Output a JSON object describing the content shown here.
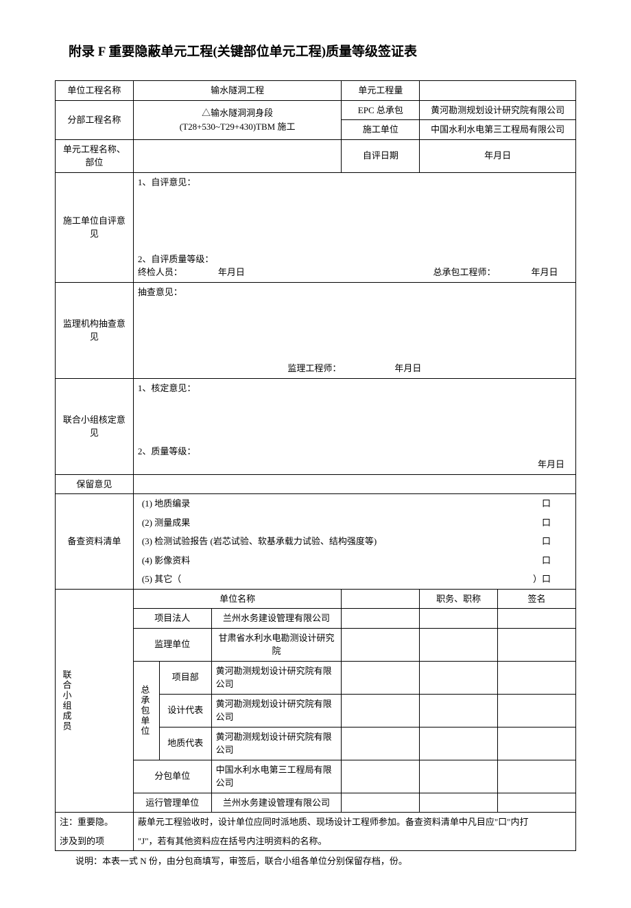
{
  "title": "附录 F 重要隐蔽单元工程(关键部位单元工程)质量等级签证表",
  "labels": {
    "unit_project_name": "单位工程名称",
    "unit_project_qty": "单元工程量",
    "subdivision_name": "分部工程名称",
    "epc_contractor": "EPC 总承包",
    "construction_unit": "施工单位",
    "unit_name_part": "单元工程名称、部位",
    "self_eval_date": "自评日期",
    "date_placeholder": "年月日",
    "contractor_self_opinion": "施工单位自评意见",
    "self_opinion_1": "1、自评意见：",
    "self_opinion_2": "2、自评质量等级：",
    "final_inspector": "终检人员：",
    "general_engineer": "总承包工程师：",
    "supervision_spot": "监理机构抽查意见",
    "spot_check": "抽查意见：",
    "supervision_engineer": "监理工程师：",
    "joint_group_verify": "联合小组核定意见",
    "verify_1": "1、核定意见：",
    "verify_2": "2、质量等级：",
    "reserved_opinion": "保留意见",
    "checklist": "备查资料清单",
    "checklist_1": "(1) 地质编录",
    "checklist_2": "(2) 测量成果",
    "checklist_3": "(3) 检测试验报告 (岩芯试验、软基承载力试验、结构强度等)",
    "checklist_4": "(4) 影像资料",
    "checklist_5": "(5) 其它（",
    "checklist_5_close": "）口",
    "marker": "口",
    "joint_members": "联合小组成员",
    "org_name": "单位名称",
    "position": "职务、职称",
    "signature": "签名",
    "project_owner": "项目法人",
    "supervision_org": "监理单位",
    "general_contractor_unit": "总承包单位",
    "project_dept": "项目部",
    "design_rep": "设计代表",
    "geo_rep": "地质代表",
    "subcontractor": "分包单位",
    "operation_mgmt": "运行管理单位"
  },
  "values": {
    "unit_project_name": "输水隧洞工程",
    "subdivision_name_line1": "△输水隧洞洞身段",
    "subdivision_name_line2": "(T28+530~T29+430)TBM 施工",
    "epc_contractor": "黄河勘测规划设计研究院有限公司",
    "construction_unit": "中国水利水电第三工程局有限公司",
    "project_owner_org": "兰州水务建设管理有限公司",
    "supervision_org_name": "甘肃省水利水电勘测设计研究院",
    "project_dept_org": "黄河勘测规划设计研究院有限公司",
    "design_rep_org": "黄河勘测规划设计研究院有限公司",
    "geo_rep_org": "黄河勘测规划设计研究院有限公司",
    "subcontractor_org": "中国水利水电第三工程局有限公司",
    "operation_mgmt_org": "兰州水务建设管理有限公司"
  },
  "notes": {
    "line1_label": "注：重要隐。",
    "line1_text": "蔽单元工程验收时，设计单位应同时派地质、现场设计工程师参加。备查资料清单中凡目应\"口\"内打",
    "line2_label": "涉及到的项",
    "line2_text": "\"J\"，若有其他资料应在括号内注明资料的名称。",
    "explanation": "说明：本表一式 N 份，由分包商填写，审签后，联合小组各单位分别保留存档，份。"
  }
}
